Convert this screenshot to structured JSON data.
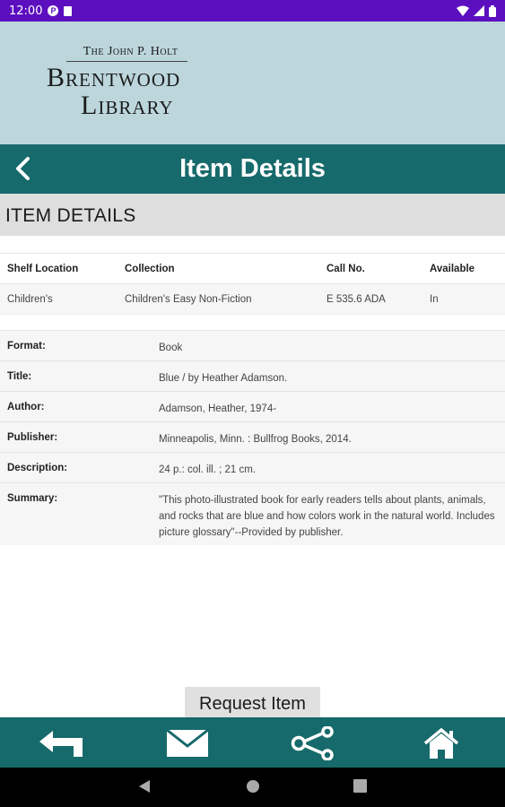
{
  "status_bar": {
    "time": "12:00",
    "p_icon_letter": "P"
  },
  "header": {
    "logo_small": "The John P. Holt",
    "logo_line1": "Brentwood",
    "logo_line2": "Library"
  },
  "titlebar": {
    "title": "Item Details"
  },
  "section": {
    "heading": "ITEM DETAILS"
  },
  "holdings": {
    "headers": [
      "Shelf Location",
      "Collection",
      "Call No.",
      "Available"
    ],
    "row": [
      "Children's",
      "Children's Easy Non-Fiction",
      "E 535.6 ADA",
      "In"
    ]
  },
  "details": [
    {
      "label": "Format:",
      "value": "Book"
    },
    {
      "label": "Title:",
      "value": "Blue / by Heather Adamson."
    },
    {
      "label": "Author:",
      "value": "Adamson, Heather, 1974-"
    },
    {
      "label": "Publisher:",
      "value": "Minneapolis, Minn. : Bullfrog Books, 2014."
    },
    {
      "label": "Description:",
      "value": "24 p.: col. ill. ; 21 cm."
    },
    {
      "label": "Summary:",
      "value": "\"This photo-illustrated book for early readers tells about plants, animals, and rocks that are blue and how colors work in the natural world. Includes picture glossary\"--Provided by publisher."
    }
  ],
  "actions": {
    "request_label": "Request Item"
  },
  "toolbar": {
    "icons": [
      "reply-icon",
      "mail-icon",
      "share-icon",
      "home-icon"
    ]
  },
  "colors": {
    "status_bar": "#5c0fbf",
    "banner": "#bcd6dc",
    "brand_teal": "#176a6b",
    "section_gray": "#dedede"
  }
}
